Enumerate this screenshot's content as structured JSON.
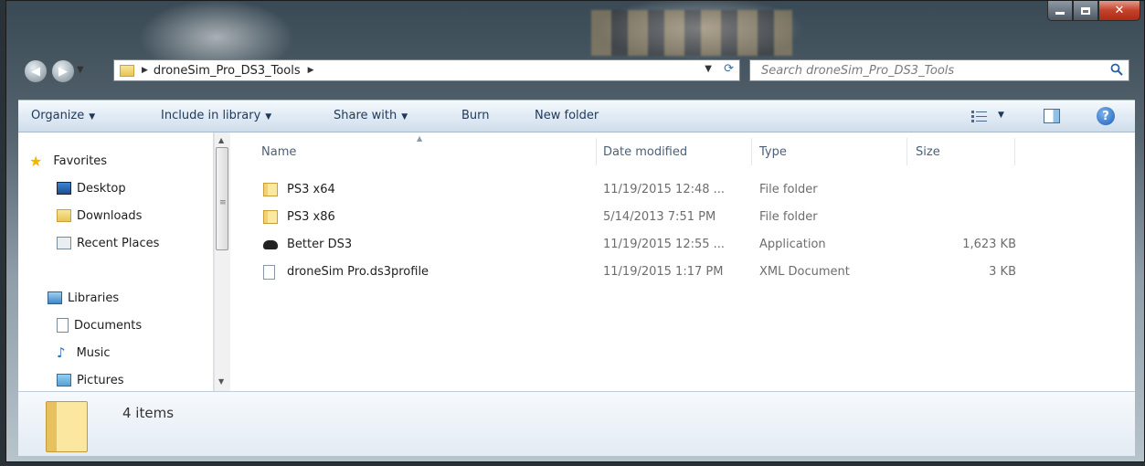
{
  "address": {
    "path": "droneSim_Pro_DS3_Tools"
  },
  "search": {
    "placeholder": "Search droneSim_Pro_DS3_Tools"
  },
  "toolbar": {
    "organize": "Organize",
    "include_in_library": "Include in library",
    "share_with": "Share with",
    "burn": "Burn",
    "new_folder": "New folder"
  },
  "navpane": {
    "favorites": "Favorites",
    "desktop": "Desktop",
    "downloads": "Downloads",
    "recent_places": "Recent Places",
    "libraries": "Libraries",
    "documents": "Documents",
    "music": "Music",
    "pictures": "Pictures"
  },
  "columns": {
    "name": "Name",
    "date_modified": "Date modified",
    "type": "Type",
    "size": "Size"
  },
  "files": [
    {
      "name": "PS3 x64",
      "date": "11/19/2015 12:48 ...",
      "type": "File folder",
      "size": "",
      "icon": "folder-icon"
    },
    {
      "name": "PS3 x86",
      "date": "5/14/2013 7:51 PM",
      "type": "File folder",
      "size": "",
      "icon": "folder-icon"
    },
    {
      "name": "Better DS3",
      "date": "11/19/2015 12:55 ...",
      "type": "Application",
      "size": "1,623 KB",
      "icon": "gamepad-icon"
    },
    {
      "name": "droneSim Pro.ds3profile",
      "date": "11/19/2015 1:17 PM",
      "type": "XML Document",
      "size": "3 KB",
      "icon": "xml-document-icon"
    }
  ],
  "details": {
    "item_count": "4 items"
  }
}
